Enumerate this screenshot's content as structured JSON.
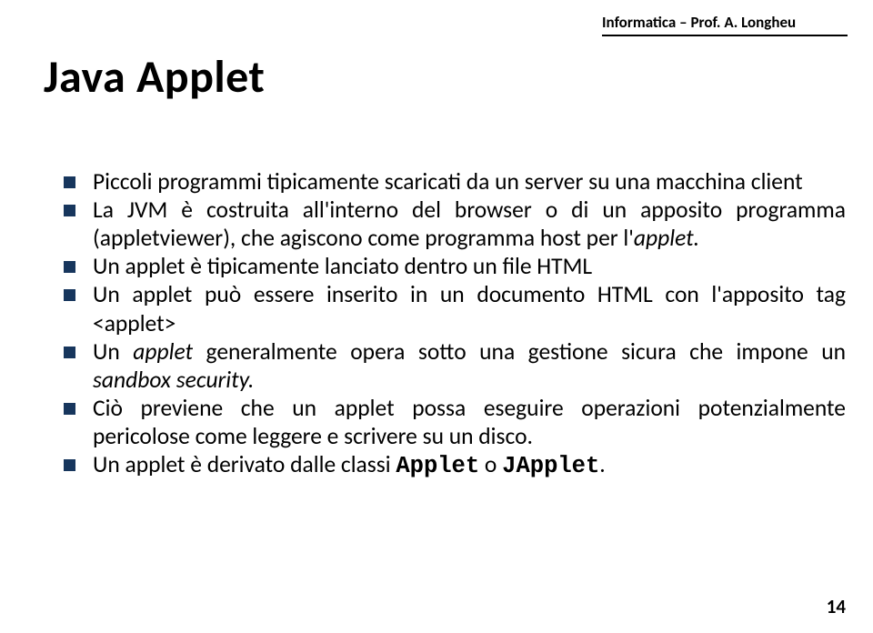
{
  "header": {
    "text": "Informatica – Prof. A. Longheu"
  },
  "title": "Java Applet",
  "bullets": {
    "b1": "Piccoli programmi tipicamente scaricati da un server su una macchina client",
    "b2_a": "La JVM è costruita all'interno del browser o di un apposito programma (appletviewer), che agiscono come programma host per l'",
    "b2_i": "applet.",
    "b3": "Un applet  è tipicamente lanciato dentro un file HTML",
    "b4": "Un applet può essere inserito in un documento HTML con l'apposito tag <applet>",
    "b5_a": "Un ",
    "b5_i1": "applet",
    "b5_b": " generalmente opera sotto una gestione sicura che impone un ",
    "b5_i2": "sandbox security.",
    "b6": "Ciò previene che un applet possa eseguire operazioni potenzialmente pericolose come leggere e scrivere su un disco.",
    "b7_a": "Un applet è derivato dalle classi ",
    "b7_m1": "Applet",
    "b7_b": " o ",
    "b7_m2": "JApplet",
    "b7_c": "."
  },
  "page_number": "14"
}
